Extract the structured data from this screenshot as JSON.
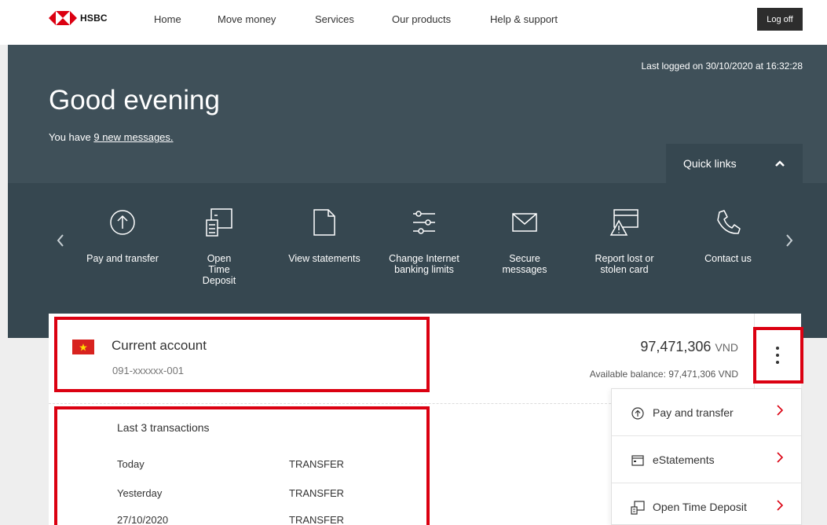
{
  "brand": {
    "name": "HSBC",
    "color": "#db0011"
  },
  "nav": {
    "items": [
      "Home",
      "Move money",
      "Services",
      "Our products",
      "Help & support"
    ],
    "logoff_label": "Log off"
  },
  "hero": {
    "last_logged": "Last logged on 30/10/2020 at 16:32:28",
    "greeting": "Good evening",
    "messages_prefix": "You have ",
    "messages_link": "9 new messages.",
    "quick_links_label": "Quick links"
  },
  "quick_links": [
    {
      "icon": "arrow-up-circle-icon",
      "label": "Pay and transfer"
    },
    {
      "icon": "time-deposit-icon",
      "label": "Open Time Deposit"
    },
    {
      "icon": "document-icon",
      "label": "View statements"
    },
    {
      "icon": "sliders-icon",
      "label": "Change Internet banking limits"
    },
    {
      "icon": "envelope-icon",
      "label": "Secure messages"
    },
    {
      "icon": "card-warning-icon",
      "label": "Report lost or stolen card"
    },
    {
      "icon": "phone-icon",
      "label": "Contact us"
    }
  ],
  "account": {
    "flag": "vietnam-flag-icon",
    "name": "Current account",
    "number": "091-xxxxxx-001",
    "balance": "97,471,306",
    "currency": "VND",
    "available": "Available balance: 97,471,306 VND"
  },
  "transactions": {
    "title": "Last 3 transactions",
    "rows": [
      {
        "date": "Today",
        "type": "TRANSFER"
      },
      {
        "date": "Yesterday",
        "type": "TRANSFER"
      },
      {
        "date": "27/10/2020",
        "type": "TRANSFER"
      }
    ]
  },
  "account_menu": [
    {
      "icon": "arrow-up-circle-icon",
      "label": "Pay and transfer"
    },
    {
      "icon": "statement-icon",
      "label": "eStatements"
    },
    {
      "icon": "time-deposit-icon",
      "label": "Open Time Deposit"
    }
  ],
  "colors": {
    "hero_bg": "#3f5059",
    "quicklinks_bg": "#364750",
    "highlight": "#db0011"
  }
}
